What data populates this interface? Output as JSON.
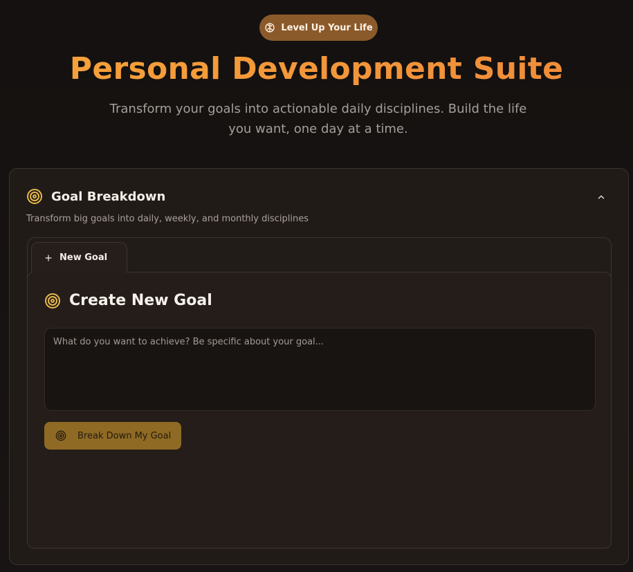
{
  "hero": {
    "badge_label": "Level Up Your Life",
    "badge_icon": "brain-icon",
    "title": "Personal Development Suite",
    "subtitle": "Transform your goals into actionable daily disciplines. Build the life you want, one day at a time."
  },
  "goal_card": {
    "title": "Goal Breakdown",
    "icon": "target-icon",
    "description": "Transform big goals into daily, weekly, and monthly disciplines",
    "collapse_icon": "chevron-up-icon"
  },
  "tabs": [
    {
      "label": "New Goal",
      "icon": "plus-icon",
      "active": true
    }
  ],
  "create_goal": {
    "title": "Create New Goal",
    "icon": "target-icon",
    "input_placeholder": "What do you want to achieve? Be specific about your goal...",
    "input_value": "",
    "submit_label": "Break Down My Goal",
    "submit_icon": "target-icon"
  },
  "colors": {
    "background": "#161312",
    "card": "#211b18",
    "accent_orange": "#f39a3c",
    "accent_gold": "#e9b949",
    "badge": "#8a5a2b",
    "button": "#8e6a24"
  }
}
